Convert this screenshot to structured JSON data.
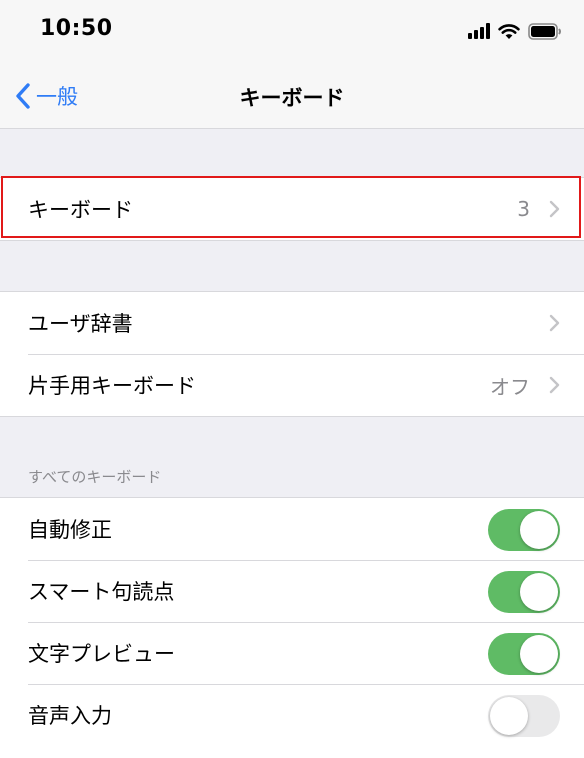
{
  "status_bar": {
    "time": "10:50"
  },
  "nav": {
    "back_label": "一般",
    "title": "キーボード"
  },
  "group1": [
    {
      "label": "キーボード",
      "value": "3"
    }
  ],
  "group2": [
    {
      "label": "ユーザ辞書",
      "value": ""
    },
    {
      "label": "片手用キーボード",
      "value": "オフ"
    }
  ],
  "section_header": "すべてのキーボード",
  "toggles": [
    {
      "label": "自動修正",
      "on": true
    },
    {
      "label": "スマート句読点",
      "on": true
    },
    {
      "label": "文字プレビュー",
      "on": true
    },
    {
      "label": "音声入力",
      "on": false
    }
  ],
  "colors": {
    "accent": "#2f7cf6",
    "toggle_on": "#5fbb65",
    "highlight": "#e11919"
  },
  "icons": [
    "cellular-signal-icon",
    "wifi-icon",
    "battery-icon",
    "chevron-left-icon",
    "chevron-right-icon"
  ]
}
